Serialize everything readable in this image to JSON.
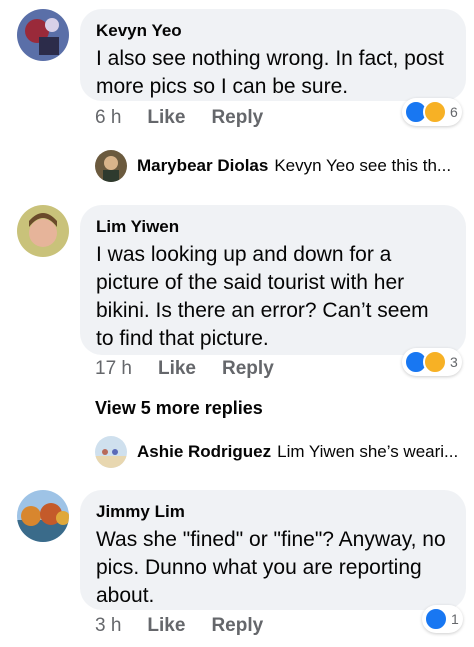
{
  "comments": [
    {
      "author": "Kevyn Yeo",
      "text": "I also see nothing wrong. In fact, post more pics so I can be sure.",
      "time": "6 h",
      "like": "Like",
      "reply": "Reply",
      "reaction_count": "6",
      "reactions": [
        "like-icon",
        "haha-icon"
      ],
      "reply_preview": {
        "name": "Marybear Diolas",
        "text": "Kevyn Yeo  see this th..."
      }
    },
    {
      "author": "Lim Yiwen",
      "text": "I was looking up and down for a picture of the said tourist with her bikini. Is there an error? Can’t seem to find that picture.",
      "time": "17 h",
      "like": "Like",
      "reply": "Reply",
      "reaction_count": "3",
      "reactions": [
        "like-icon",
        "haha-icon"
      ],
      "more_replies": "View 5 more replies",
      "reply_preview": {
        "name": "Ashie Rodriguez",
        "text": "Lim Yiwen she’s weari..."
      }
    },
    {
      "author": "Jimmy Lim",
      "text": "Was she \"fined\" or \"fine\"? Anyway, no pics. Dunno what you are reporting about.",
      "time": "3 h",
      "like": "Like",
      "reply": "Reply",
      "reaction_count": "1",
      "reactions": [
        "like-icon"
      ]
    }
  ],
  "colors": {
    "like_blue": "#1877f2",
    "haha_yellow": "#f7b125",
    "bubble_bg": "#f0f2f5",
    "meta_gray": "#65676b"
  }
}
